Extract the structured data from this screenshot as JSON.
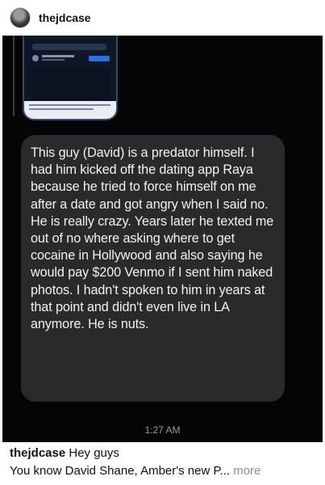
{
  "post": {
    "username": "thejdcase"
  },
  "screenshot": {
    "message": "This guy (David) is a predator himself. I had him kicked off the dating app Raya because he tried to force himself on me after a date and got angry when I said no. He is really crazy. Years later he texted me out of no where asking where to get cocaine in Hollywood and also saying he would pay $200 Venmo if I sent him naked photos. I hadn't spoken to him in years at that point and didn't even live in LA anymore. He is nuts.",
    "time": "1:27 AM"
  },
  "caption": {
    "username": "thejdcase",
    "line1": "Hey guys",
    "line2": "You know David Shane, Amber's new P...",
    "more_label": "more"
  }
}
